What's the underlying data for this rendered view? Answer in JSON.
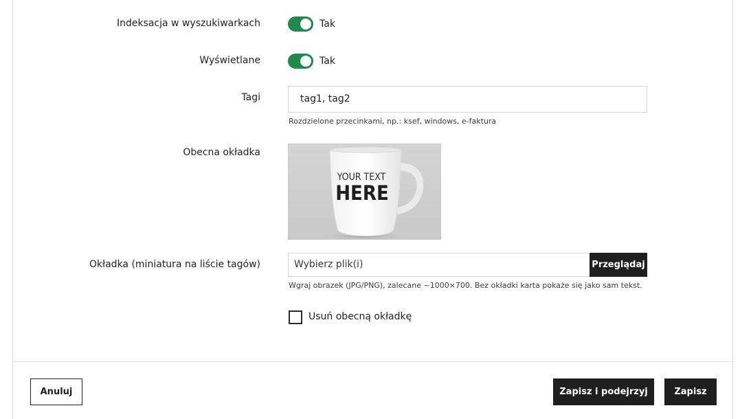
{
  "form": {
    "indexing": {
      "label": "Indeksacja w wyszukiwarkach",
      "value_text": "Tak",
      "checked": true
    },
    "displayed": {
      "label": "Wyświetlane",
      "value_text": "Tak",
      "checked": true
    },
    "tags": {
      "label": "Tagi",
      "value": "tag1, tag2",
      "help": "Rozdzielone przecinkami, np.: ksef, windows, e-faktura"
    },
    "current_cover": {
      "label": "Obecna okładka",
      "image_text_line1": "YOUR TEXT",
      "image_text_line2": "HERE"
    },
    "cover_upload": {
      "label": "Okładka (miniatura na liście tagów)",
      "placeholder": "Wybierz plik(i)",
      "browse_label": "Przeglądaj",
      "help": "Wgraj obrazek (JPG/PNG), zalecane ~1000×700. Bez okładki karta pokaże się jako sam tekst."
    },
    "remove_cover": {
      "label": "Usuń obecną okładkę",
      "checked": false
    }
  },
  "footer": {
    "cancel_label": "Anuluj",
    "save_preview_label": "Zapisz i podejrzyj",
    "save_label": "Zapisz"
  },
  "colors": {
    "toggle_on": "#218a4a",
    "button_dark": "#1f1f1f"
  }
}
